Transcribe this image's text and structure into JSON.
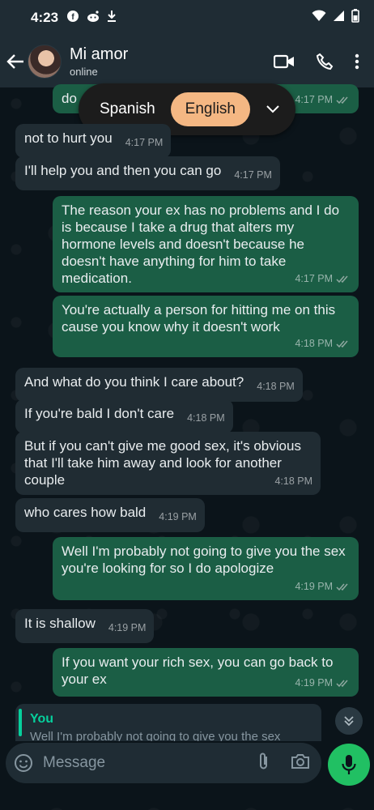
{
  "status_bar": {
    "time": "4:23"
  },
  "header": {
    "contact_name": "Mi amor",
    "contact_status": "online"
  },
  "translate_bar": {
    "source_lang": "Spanish",
    "target_lang": "English"
  },
  "messages": [
    {
      "dir": "out",
      "text": "do",
      "time": "4:17 PM"
    },
    {
      "dir": "in",
      "text": "not to hurt you",
      "time": "4:17 PM"
    },
    {
      "dir": "in",
      "text": "I'll help you and then you can go",
      "time": "4:17 PM"
    },
    {
      "dir": "out",
      "text": "The reason your ex has no problems and I do is because I take a drug that alters my hormone levels and doesn't because he doesn't have anything for him to take medication.",
      "time": "4:17 PM"
    },
    {
      "dir": "out",
      "text": "You're actually a person for hitting me on this cause you know why it doesn't work",
      "time": "4:18 PM"
    },
    {
      "dir": "in",
      "text": "And what do you think I care about?",
      "time": "4:18 PM"
    },
    {
      "dir": "in",
      "text": "If you're bald I don't care",
      "time": "4:18 PM"
    },
    {
      "dir": "in",
      "text": "But if you can't give me good sex, it's obvious that I'll take him away and look for another couple",
      "time": "4:18 PM"
    },
    {
      "dir": "in",
      "text": "who cares how bald",
      "time": "4:19 PM"
    },
    {
      "dir": "out",
      "text": "Well I'm probably not going to give you the sex you're looking for so I do apologize",
      "time": "4:19 PM"
    },
    {
      "dir": "in",
      "text": "It is shallow",
      "time": "4:19 PM"
    },
    {
      "dir": "out",
      "text": "If you want your rich sex, you can go back to your ex",
      "time": "4:19 PM"
    }
  ],
  "reply_preview": {
    "author": "You",
    "text": "Well I'm probably not going to give you the sex"
  },
  "composer": {
    "placeholder": "Message"
  }
}
